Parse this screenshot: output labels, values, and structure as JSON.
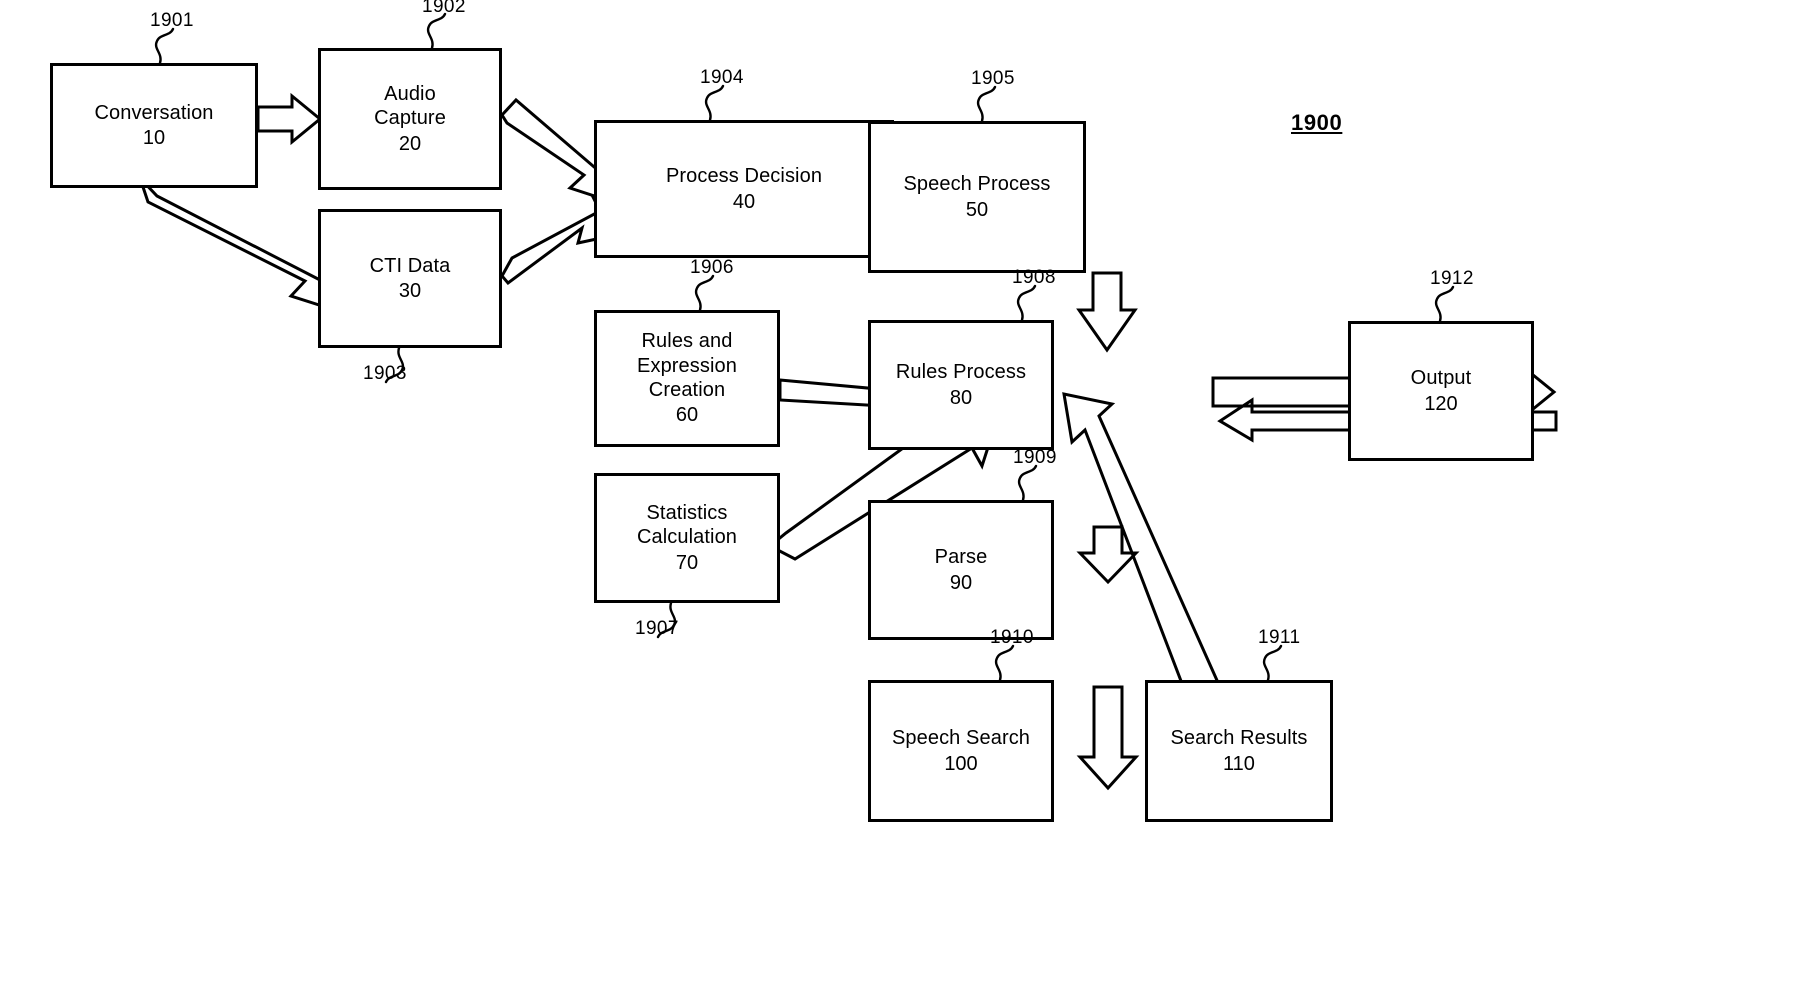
{
  "figure": {
    "number": "1900",
    "type": "patent-flow-diagram"
  },
  "nodes": [
    {
      "id": "conversation",
      "title": "Conversation",
      "number": "10",
      "ref": "1901",
      "ref_pos": "top"
    },
    {
      "id": "audio-capture",
      "title": "Audio\nCapture",
      "number": "20",
      "ref": "1902",
      "ref_pos": "top"
    },
    {
      "id": "cti-data",
      "title": "CTI Data",
      "number": "30",
      "ref": "1903",
      "ref_pos": "bottom"
    },
    {
      "id": "process-decision",
      "title": "Process Decision",
      "number": "40",
      "ref": "1904",
      "ref_pos": "top"
    },
    {
      "id": "speech-process",
      "title": "Speech Process",
      "number": "50",
      "ref": "1905",
      "ref_pos": "top"
    },
    {
      "id": "rules-expression-creation",
      "title": "Rules and\nExpression\nCreation",
      "number": "60",
      "ref": "1906",
      "ref_pos": "top"
    },
    {
      "id": "statistics-calculation",
      "title": "Statistics\nCalculation",
      "number": "70",
      "ref": "1907",
      "ref_pos": "bottom"
    },
    {
      "id": "rules-process",
      "title": "Rules Process",
      "number": "80",
      "ref": "1908",
      "ref_pos": "top"
    },
    {
      "id": "parse",
      "title": "Parse",
      "number": "90",
      "ref": "1909",
      "ref_pos": "top"
    },
    {
      "id": "speech-search",
      "title": "Speech Search",
      "number": "100",
      "ref": "1910",
      "ref_pos": "top"
    },
    {
      "id": "search-results",
      "title": "Search Results",
      "number": "110",
      "ref": "1911",
      "ref_pos": "top"
    },
    {
      "id": "output",
      "title": "Output",
      "number": "120",
      "ref": "1912",
      "ref_pos": "top"
    }
  ],
  "edges": [
    {
      "from": "conversation",
      "to": "audio-capture"
    },
    {
      "from": "conversation",
      "to": "cti-data"
    },
    {
      "from": "audio-capture",
      "to": "process-decision"
    },
    {
      "from": "cti-data",
      "to": "process-decision"
    },
    {
      "from": "process-decision",
      "to": "speech-process"
    },
    {
      "from": "speech-process",
      "to": "rules-process"
    },
    {
      "from": "rules-expression-creation",
      "to": "rules-process"
    },
    {
      "from": "statistics-calculation",
      "to": "rules-process"
    },
    {
      "from": "rules-process",
      "to": "output"
    },
    {
      "from": "output",
      "to": "rules-process"
    },
    {
      "from": "rules-process",
      "to": "parse"
    },
    {
      "from": "parse",
      "to": "speech-search"
    },
    {
      "from": "speech-search",
      "to": "search-results"
    },
    {
      "from": "search-results",
      "to": "rules-process"
    }
  ],
  "colors": {
    "stroke": "#000000",
    "fill": "#ffffff",
    "background": "#ffffff"
  }
}
